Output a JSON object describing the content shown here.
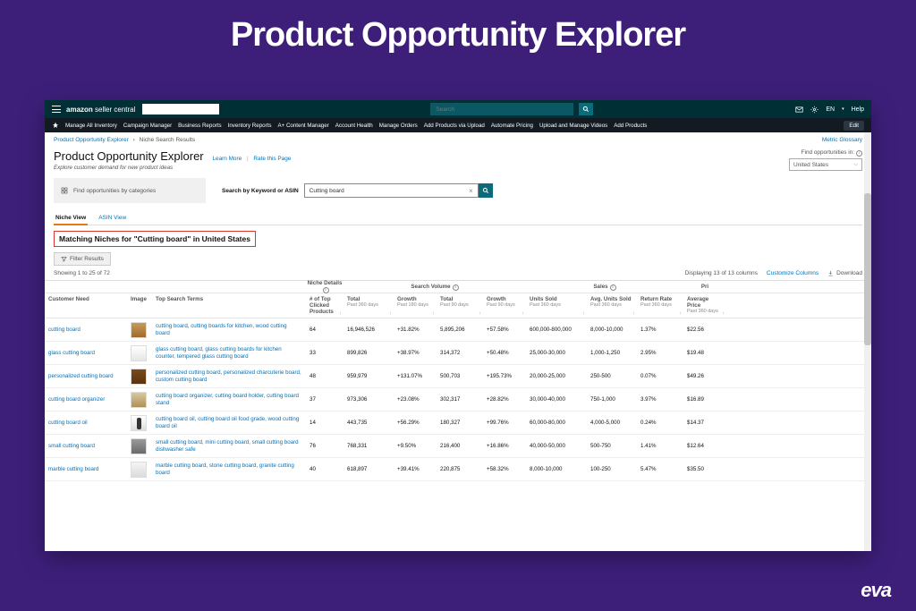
{
  "slideTitle": "Product Opportunity Explorer",
  "brand": {
    "main": "amazon",
    "sub": "seller central"
  },
  "topSearch": {
    "placeholder": "Search"
  },
  "topIcons": {
    "lang": "EN",
    "help": "Help"
  },
  "nav": [
    "Manage All Inventory",
    "Campaign Manager",
    "Business Reports",
    "Inventory Reports",
    "A+ Content Manager",
    "Account Health",
    "Manage Orders",
    "Add Products via Upload",
    "Automate Pricing",
    "Upload and Manage Videos",
    "Add Products"
  ],
  "navEdit": "Edit",
  "breadcrumb": {
    "a": "Product Opportunity Explorer",
    "b": "Niche Search Results",
    "glossary": "Metric Glossary"
  },
  "header": {
    "title": "Product Opportunity Explorer",
    "learn": "Learn More",
    "rate": "Rate this Page",
    "subtitle": "Explore customer demand for new product ideas"
  },
  "region": {
    "label": "Find opportunities in:",
    "value": "United States"
  },
  "cats": "Find opportunities by categories",
  "kwLabel": "Search by Keyword or ASIN",
  "kwValue": "Cutting board",
  "tabs": {
    "niche": "Niche View",
    "asin": "ASIN View"
  },
  "matching": "Matching Niches for \"Cutting board\" in United States",
  "filter": "Filter Results",
  "showing": "Showing 1 to 25 of 72",
  "displayInfo": "Displaying 13 of 13 columns",
  "customize": "Customize Columns",
  "download": "Download",
  "groups": {
    "niche": "Niche Details",
    "search": "Search Volume",
    "sales": "Sales",
    "price": "Pri"
  },
  "cols": {
    "need": "Customer Need",
    "image": "Image",
    "terms": "Top Search Terms",
    "clicked": "# of Top Clicked Products",
    "total360": "Total",
    "sub360": "Past 360 days",
    "growth180": "Growth",
    "sub180": "Past 180 days",
    "total90": "Total",
    "sub90": "Past 90 days",
    "growth90": "Growth",
    "sub90b": "Past 90 days",
    "units": "Units Sold",
    "subU": "Past 360 days",
    "avgUnits": "Avg. Units Sold",
    "subA": "Past 360 days",
    "return": "Return Rate",
    "subR": "Past 360 days",
    "avgPrice": "Average Price",
    "subP": "Past 360 days"
  },
  "rows": [
    {
      "need": "cutting board",
      "thumb": "t-bamboo",
      "terms": "cutting board, cutting boards for kitchen, wood cutting board",
      "clicked": "64",
      "t360": "16,946,526",
      "g180": "+31.82%",
      "t90": "5,895,206",
      "g90": "+57.58%",
      "units": "600,000-800,000",
      "avg": "8,000-10,000",
      "ret": "1.37%",
      "price": "$22.56"
    },
    {
      "need": "glass cutting board",
      "thumb": "t-glass",
      "terms": "glass cutting board, glass cutting boards for kitchen counter, tempered glass cutting board",
      "clicked": "33",
      "t360": "899,826",
      "g180": "+38.97%",
      "t90": "314,372",
      "g90": "+50.48%",
      "units": "25,000-30,000",
      "avg": "1,000-1,250",
      "ret": "2.95%",
      "price": "$19.48"
    },
    {
      "need": "personalized cutting board",
      "thumb": "t-wood",
      "terms": "personalized cutting board, personalized charcuterie board, custom cutting board",
      "clicked": "48",
      "t360": "959,979",
      "g180": "+131.07%",
      "t90": "500,703",
      "g90": "+195.73%",
      "units": "20,000-25,000",
      "avg": "250-500",
      "ret": "0.07%",
      "price": "$49.26"
    },
    {
      "need": "cutting board organizer",
      "thumb": "t-org",
      "terms": "cutting board organizer, cutting board holder, cutting board stand",
      "clicked": "37",
      "t360": "973,306",
      "g180": "+23.08%",
      "t90": "302,317",
      "g90": "+28.82%",
      "units": "30,000-40,000",
      "avg": "750-1,000",
      "ret": "3.97%",
      "price": "$16.89"
    },
    {
      "need": "cutting board oil",
      "thumb": "t-oil",
      "terms": "cutting board oil, cutting board oil food grade, wood cutting board oil",
      "clicked": "14",
      "t360": "443,735",
      "g180": "+56.29%",
      "t90": "180,327",
      "g90": "+99.76%",
      "units": "60,000-80,000",
      "avg": "4,000-5,000",
      "ret": "0.24%",
      "price": "$14.37"
    },
    {
      "need": "small cutting board",
      "thumb": "t-small",
      "terms": "small cutting board, mini cutting board, small cutting board dishwasher safe",
      "clicked": "76",
      "t360": "768,331",
      "g180": "+9.50%",
      "t90": "216,400",
      "g90": "+16.86%",
      "units": "40,000-50,000",
      "avg": "500-750",
      "ret": "1.41%",
      "price": "$12.64"
    },
    {
      "need": "marble cutting board",
      "thumb": "t-marble",
      "terms": "marble cutting board, stone cutting board, granite cutting board",
      "clicked": "40",
      "t360": "618,897",
      "g180": "+39.41%",
      "t90": "220,875",
      "g90": "+58.32%",
      "units": "8,000-10,000",
      "avg": "100-250",
      "ret": "5.47%",
      "price": "$35.50"
    }
  ],
  "chart_data": {
    "type": "table",
    "title": "Matching Niches for \"Cutting board\" in United States",
    "columns": [
      "Customer Need",
      "# of Top Clicked Products",
      "Total (Past 360 days)",
      "Growth (Past 180 days)",
      "Total (Past 90 days)",
      "Growth (Past 90 days)",
      "Units Sold (Past 360 days)",
      "Avg. Units Sold (Past 360 days)",
      "Return Rate (Past 360 days)",
      "Average Price (Past 360 days)"
    ],
    "rows": [
      [
        "cutting board",
        64,
        16946526,
        31.82,
        5895206,
        57.58,
        "600,000-800,000",
        "8,000-10,000",
        1.37,
        22.56
      ],
      [
        "glass cutting board",
        33,
        899826,
        38.97,
        314372,
        50.48,
        "25,000-30,000",
        "1,000-1,250",
        2.95,
        19.48
      ],
      [
        "personalized cutting board",
        48,
        959979,
        131.07,
        500703,
        195.73,
        "20,000-25,000",
        "250-500",
        0.07,
        49.26
      ],
      [
        "cutting board organizer",
        37,
        973306,
        23.08,
        302317,
        28.82,
        "30,000-40,000",
        "750-1,000",
        3.97,
        16.89
      ],
      [
        "cutting board oil",
        14,
        443735,
        56.29,
        180327,
        99.76,
        "60,000-80,000",
        "4,000-5,000",
        0.24,
        14.37
      ],
      [
        "small cutting board",
        76,
        768331,
        9.5,
        216400,
        16.86,
        "40,000-50,000",
        "500-750",
        1.41,
        12.64
      ],
      [
        "marble cutting board",
        40,
        618897,
        39.41,
        220875,
        58.32,
        "8,000-10,000",
        "100-250",
        5.47,
        35.5
      ]
    ]
  },
  "eva": "eva"
}
